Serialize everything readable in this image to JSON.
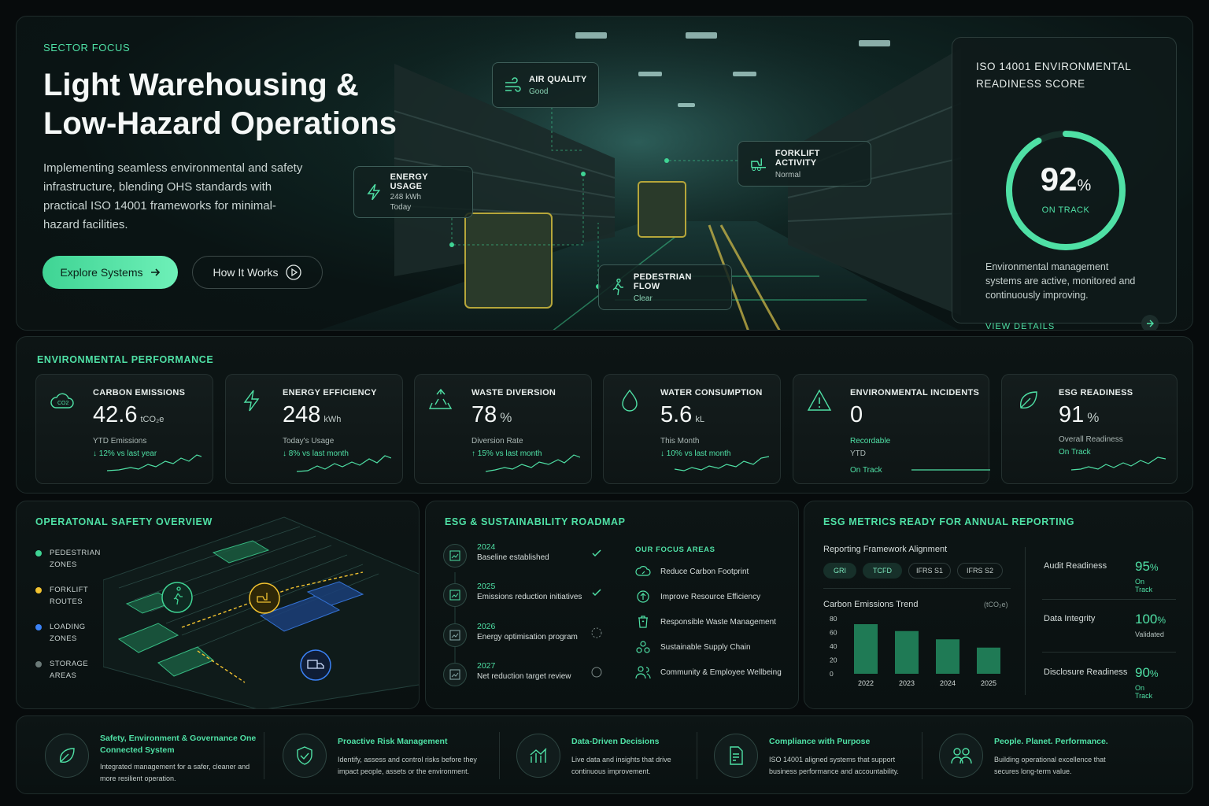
{
  "hero": {
    "sector": "SECTOR FOCUS",
    "title_line1": "Light Warehousing &",
    "title_line2": "Low-Hazard Operations",
    "description": "Implementing seamless environmental and safety infrastructure, blending OHS standards with practical ISO 14001 frameworks for minimal-hazard facilities.",
    "primary_button": "Explore Systems",
    "secondary_button": "How It Works",
    "callouts": {
      "air_quality": {
        "title": "AIR QUALITY",
        "status": "Good"
      },
      "energy_usage": {
        "title": "ENERGY USAGE",
        "value": "248 kWh",
        "period": "Today"
      },
      "forklift_activity": {
        "title": "FORKLIFT ACTIVITY",
        "status": "Normal"
      },
      "pedestrian_flow": {
        "title": "PEDESTRIAN FLOW",
        "status": "Clear"
      }
    }
  },
  "iso_card": {
    "title": "ISO 14001 ENVIRONMENTAL READINESS SCORE",
    "score": "92",
    "percent_sign": "%",
    "score_fraction": 0.92,
    "status": "ON TRACK",
    "description": "Environmental management systems are active, monitored and continuously improving.",
    "link": "VIEW DETAILS"
  },
  "environmental_performance": {
    "title": "ENVIRONMENTAL PERFORMANCE",
    "metrics": [
      {
        "icon": "co2-cloud-icon",
        "title": "CARBON EMISSIONS",
        "value": "42.6",
        "unit": "tCO₂e",
        "sub": "YTD Emissions",
        "change": "↓ 12% vs last year"
      },
      {
        "icon": "lightning-icon",
        "title": "ENERGY EFFICIENCY",
        "value": "248",
        "unit": "kWh",
        "sub": "Today's Usage",
        "change": "↓ 8% vs last month"
      },
      {
        "icon": "recycle-icon",
        "title": "WASTE DIVERSION",
        "value": "78",
        "unit": "%",
        "sub": "Diversion Rate",
        "change": "↑ 15% vs last month"
      },
      {
        "icon": "water-drop-icon",
        "title": "WATER CONSUMPTION",
        "value": "5.6",
        "unit": "kL",
        "sub": "This Month",
        "change": "↓ 10% vs last month"
      },
      {
        "icon": "warning-triangle-icon",
        "title": "ENVIRONMENTAL INCIDENTS",
        "value": "0",
        "unit": "",
        "sub": "Recordable",
        "sub2": "YTD",
        "change": "On Track"
      },
      {
        "icon": "leaf-icon",
        "title": "ESG READINESS",
        "value": "91",
        "unit": "%",
        "sub": "Overall Readiness",
        "change": "On Track"
      }
    ]
  },
  "safety": {
    "title": "OPERATONAL SAFETY OVERVIEW",
    "legend": [
      {
        "label": "PEDESTRIAN ZONES",
        "color": "#3fd494"
      },
      {
        "label": "FORKLIFT ROUTES",
        "color": "#f2c230"
      },
      {
        "label": "LOADING ZONES",
        "color": "#3b82f6"
      },
      {
        "label": "STORAGE AREAS",
        "color": "#6b7a78"
      }
    ]
  },
  "roadmap": {
    "title": "ESG & SUSTAINABILITY ROADMAP",
    "steps": [
      {
        "year": "2024",
        "text": "Baseline established",
        "done": true
      },
      {
        "year": "2025",
        "text": "Emissions reduction initiatives",
        "done": true
      },
      {
        "year": "2026",
        "text": "Energy optimisation program",
        "done": false
      },
      {
        "year": "2027",
        "text": "Net reduction target review",
        "done": false
      }
    ],
    "focus_title": "OUR FOCUS AREAS",
    "focus_areas": [
      {
        "icon": "cloud-leaf-icon",
        "label": "Reduce Carbon Footprint"
      },
      {
        "icon": "resource-cycle-icon",
        "label": "Improve Resource Efficiency"
      },
      {
        "icon": "bin-icon",
        "label": "Responsible Waste Management"
      },
      {
        "icon": "supply-chain-icon",
        "label": "Sustainable Supply Chain"
      },
      {
        "icon": "people-icon",
        "label": "Community & Employee Wellbeing"
      }
    ]
  },
  "esg_metrics": {
    "title": "ESG METRICS READY FOR ANNUAL REPORTING",
    "framework_title": "Reporting Framework Alignment",
    "frameworks": [
      {
        "label": "GRI",
        "active": true
      },
      {
        "label": "TCFD",
        "active": true
      },
      {
        "label": "IFRS S1",
        "active": false
      },
      {
        "label": "IFRS S2",
        "active": false
      }
    ],
    "kpis": [
      {
        "label": "Audit Readiness",
        "value": "95",
        "unit": "%",
        "status": "On Track"
      },
      {
        "label": "Data Integrity",
        "value": "100",
        "unit": "%",
        "status": "Validated"
      },
      {
        "label": "Disclosure Readiness",
        "value": "90",
        "unit": "%",
        "status": "On Track"
      }
    ]
  },
  "chart_data": {
    "type": "bar",
    "title": "Carbon Emissions Trend",
    "ylabel": "(tCO₂e)",
    "xlabel": "",
    "categories": [
      "2024",
      "2023",
      "2024",
      "2025"
    ],
    "x_labels": [
      "2022",
      "2023",
      "2024",
      "2025"
    ],
    "values": [
      72,
      62,
      50,
      38
    ],
    "yticks": [
      "80",
      "60",
      "40",
      "20",
      "0"
    ],
    "ylim": [
      0,
      80
    ],
    "grid": false,
    "color": "#1f7a55"
  },
  "strip": {
    "features": [
      {
        "icon": "leaf-icon",
        "title": "Safety, Environment & Governance One Connected System",
        "desc": "Integrated management for a safer, cleaner and more resilient operation."
      },
      {
        "icon": "shield-check-icon",
        "title": "Proactive Risk Management",
        "desc": "Identify, assess and control risks before they impact people, assets or the environment."
      },
      {
        "icon": "bar-chart-icon",
        "title": "Data-Driven Decisions",
        "desc": "Live data and insights that drive continuous improvement."
      },
      {
        "icon": "document-check-icon",
        "title": "Compliance with Purpose",
        "desc": "ISO 14001 aligned systems that support business performance and accountability."
      },
      {
        "icon": "people-icon",
        "title": "People. Planet. Performance.",
        "desc": "Building operational excellence that secures long-term value."
      }
    ]
  },
  "colors": {
    "accent": "#4fe0a5",
    "background": "#070b0c",
    "forklift": "#f2c230",
    "loading": "#3b82f6"
  }
}
